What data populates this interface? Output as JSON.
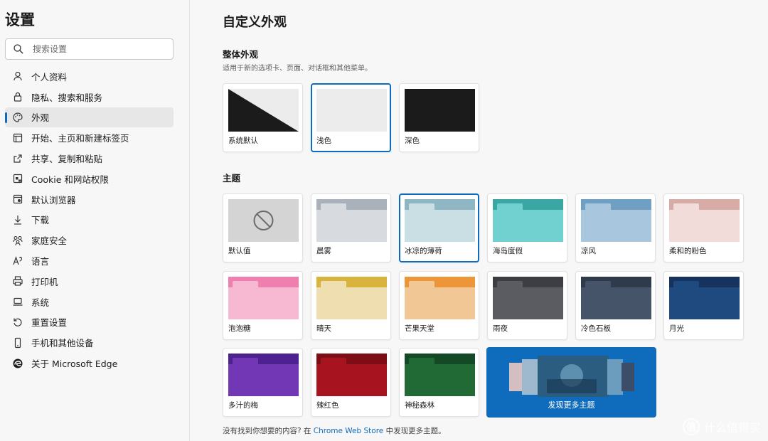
{
  "sidebar": {
    "title": "设置",
    "search_placeholder": "搜索设置",
    "items": [
      {
        "label": "个人资料",
        "icon": "profile-icon"
      },
      {
        "label": "隐私、搜索和服务",
        "icon": "lock-icon"
      },
      {
        "label": "外观",
        "icon": "palette-icon",
        "active": true
      },
      {
        "label": "开始、主页和新建标签页",
        "icon": "start-page-icon"
      },
      {
        "label": "共享、复制和粘贴",
        "icon": "share-icon"
      },
      {
        "label": "Cookie 和网站权限",
        "icon": "site-permissions-icon"
      },
      {
        "label": "默认浏览器",
        "icon": "browser-icon"
      },
      {
        "label": "下载",
        "icon": "download-icon"
      },
      {
        "label": "家庭安全",
        "icon": "family-icon"
      },
      {
        "label": "语言",
        "icon": "language-icon"
      },
      {
        "label": "打印机",
        "icon": "printer-icon"
      },
      {
        "label": "系统",
        "icon": "laptop-icon"
      },
      {
        "label": "重置设置",
        "icon": "reset-icon"
      },
      {
        "label": "手机和其他设备",
        "icon": "phone-icon"
      },
      {
        "label": "关于 Microsoft Edge",
        "icon": "edge-logo-icon"
      }
    ]
  },
  "main": {
    "title": "自定义外观",
    "overall": {
      "title": "整体外观",
      "desc": "适用于新的选项卡、页面、对话框和其他菜单。",
      "options": [
        {
          "label": "系统默认",
          "selected": false
        },
        {
          "label": "浅色",
          "selected": true
        },
        {
          "label": "深色",
          "selected": false
        }
      ]
    },
    "themes": {
      "title": "主题",
      "items": [
        {
          "label": "默认值",
          "kind": "default"
        },
        {
          "label": "晨雾",
          "band": "#a9b1ba",
          "body": "#d7dbe0",
          "tab": "#d7dbe0"
        },
        {
          "label": "冰凉的薄荷",
          "band": "#8fb6c3",
          "body": "#c9dfe4",
          "tab": "#c9dfe4",
          "selected": true
        },
        {
          "label": "海岛度假",
          "band": "#3aa7a4",
          "body": "#71d0d0",
          "tab": "#71d0d0"
        },
        {
          "label": "凉风",
          "band": "#6f9fc2",
          "body": "#a8c6dd",
          "tab": "#a8c6dd"
        },
        {
          "label": "柔和的粉色",
          "band": "#d7aca7",
          "body": "#f1dcd9",
          "tab": "#f1dcd9"
        },
        {
          "label": "泡泡糖",
          "band": "#ee7fae",
          "body": "#f7b9d2",
          "tab": "#f7b9d2"
        },
        {
          "label": "晴天",
          "band": "#d8b43d",
          "body": "#efdfb0",
          "tab": "#efdfb0"
        },
        {
          "label": "芒果天堂",
          "band": "#ec9639",
          "body": "#f1c796",
          "tab": "#f1c796"
        },
        {
          "label": "雨夜",
          "band": "#3c3e44",
          "body": "#5a5c62",
          "tab": "#5a5c62"
        },
        {
          "label": "冷色石板",
          "band": "#2f3a4a",
          "body": "#46546a",
          "tab": "#46546a"
        },
        {
          "label": "月光",
          "band": "#15335c",
          "body": "#1f4a80",
          "tab": "#1f4a80"
        },
        {
          "label": "多汁的梅",
          "band": "#4d2290",
          "body": "#7237b5",
          "tab": "#7237b5"
        },
        {
          "label": "辣红色",
          "band": "#7e0e16",
          "body": "#a7141f",
          "tab": "#a7141f"
        },
        {
          "label": "神秘森林",
          "band": "#134a25",
          "body": "#226a35",
          "tab": "#226a35"
        }
      ],
      "discover_label": "发现更多主题"
    },
    "footer": {
      "prefix": "没有找到你想要的内容? 在 ",
      "link": "Chrome Web Store",
      "suffix": " 中发现更多主题。"
    }
  },
  "watermark": {
    "badge": "值",
    "text": "什么值得买"
  },
  "colors": {
    "accent": "#0f6cbd",
    "sidebar_bg": "#f7f7f7"
  }
}
